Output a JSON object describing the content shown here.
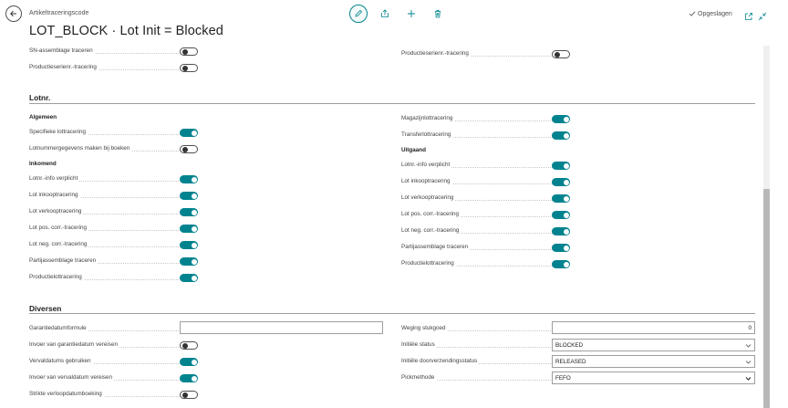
{
  "header": {
    "breadcrumb": "Artikeltraceringscode",
    "title": "LOT_BLOCK · Lot Init = Blocked",
    "saved_status": "Opgeslagen"
  },
  "top_rows": {
    "left": [
      {
        "label": "SN-assemblage traceren",
        "on": false
      },
      {
        "label": "Productieserienr.-tracering",
        "on": false
      }
    ],
    "right": [
      {
        "label": "Productieserienr.-tracering",
        "on": false
      }
    ]
  },
  "lot_section": {
    "title": "Lotnr.",
    "left_groups": [
      {
        "heading": "Algemeen",
        "items": [
          {
            "label": "Specifieke lottracering",
            "on": true
          },
          {
            "label": "Lotnummergegevens maken bij boeken",
            "on": false
          }
        ]
      },
      {
        "heading": "Inkomend",
        "items": [
          {
            "label": "Lotnr.-info verplicht",
            "on": true
          },
          {
            "label": "Lot inkooptracering",
            "on": true
          },
          {
            "label": "Lot verkooptracering",
            "on": true
          },
          {
            "label": "Lot pos. corr.-tracering",
            "on": true
          },
          {
            "label": "Lot neg. corr.-tracering",
            "on": true
          },
          {
            "label": "Partijassemblage traceren",
            "on": true
          },
          {
            "label": "Productielottracering",
            "on": true
          }
        ]
      }
    ],
    "right_top": [
      {
        "label": "Magazijnlottracering",
        "on": true
      },
      {
        "label": "Transferlottracering",
        "on": true
      }
    ],
    "right_group": {
      "heading": "Uitgaand",
      "items": [
        {
          "label": "Lotnr.-info verplicht",
          "on": true
        },
        {
          "label": "Lot inkooptracering",
          "on": true
        },
        {
          "label": "Lot verkooptracering",
          "on": true
        },
        {
          "label": "Lot pos. corr.-tracering",
          "on": true
        },
        {
          "label": "Lot neg. corr.-tracering",
          "on": true
        },
        {
          "label": "Partijassemblage traceren",
          "on": true
        },
        {
          "label": "Productielottracering",
          "on": true
        }
      ]
    }
  },
  "misc_section": {
    "title": "Diversen",
    "left": [
      {
        "label": "Garantiedatumformule",
        "type": "text",
        "value": ""
      },
      {
        "label": "Invoer van garantiedatum vereisen",
        "type": "toggle",
        "on": false
      },
      {
        "label": "Vervaldatums gebruiken",
        "type": "toggle",
        "on": true
      },
      {
        "label": "Invoer van vervaldatum vereisen",
        "type": "toggle",
        "on": true
      },
      {
        "label": "Strikte verloopdatumboeking",
        "type": "toggle",
        "on": false
      }
    ],
    "right": [
      {
        "label": "Weging stukgoed",
        "type": "number",
        "value": "0"
      },
      {
        "label": "Initiële status",
        "type": "select",
        "value": "BLOCKED"
      },
      {
        "label": "Initiële doorverzendingsstatus",
        "type": "select",
        "value": "RELEASED"
      },
      {
        "label": "Pickmethode",
        "type": "select",
        "value": "FEFO"
      }
    ]
  },
  "icons": {
    "back": "arrow-left-icon",
    "edit": "pencil-icon",
    "share": "share-icon",
    "new": "plus-icon",
    "delete": "trash-icon",
    "saved": "checkmark-icon",
    "open_new_window": "open-in-new-window-icon",
    "collapse": "collapse-icon"
  },
  "colors": {
    "accent": "#00838f",
    "toggle_off_border": "#505050",
    "section_rule": "#9e9e9e"
  }
}
